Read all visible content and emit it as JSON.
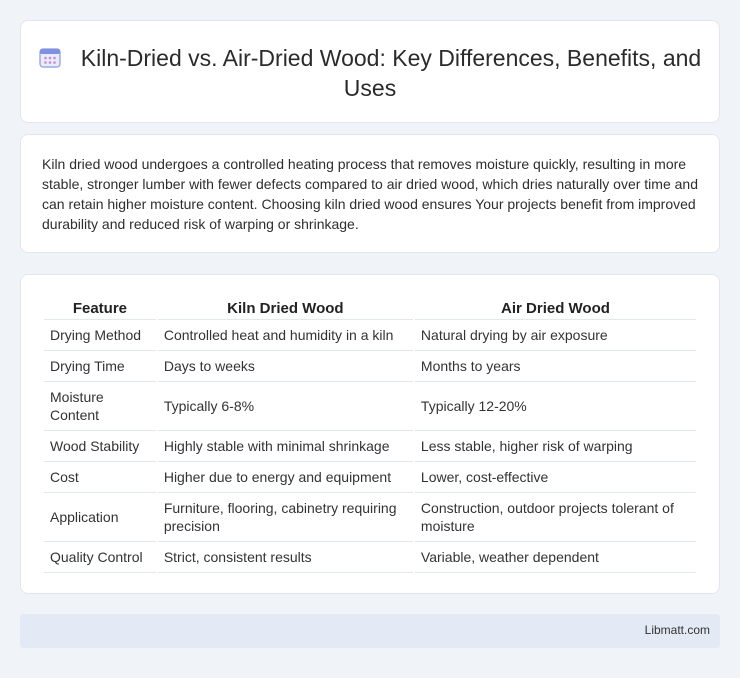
{
  "header": {
    "icon": "calendar-icon",
    "title": "Kiln-Dried vs. Air-Dried Wood: Key Differences, Benefits, and Uses"
  },
  "intro": {
    "text": "Kiln dried wood undergoes a controlled heating process that removes moisture quickly, resulting in more stable, stronger lumber with fewer defects compared to air dried wood, which dries naturally over time and can retain higher moisture content. Choosing kiln dried wood ensures Your projects benefit from improved durability and reduced risk of warping or shrinkage."
  },
  "table": {
    "headers": [
      "Feature",
      "Kiln Dried Wood",
      "Air Dried Wood"
    ],
    "rows": [
      [
        "Drying Method",
        "Controlled heat and humidity in a kiln",
        "Natural drying by air exposure"
      ],
      [
        "Drying Time",
        "Days to weeks",
        "Months to years"
      ],
      [
        "Moisture Content",
        "Typically 6-8%",
        "Typically 12-20%"
      ],
      [
        "Wood Stability",
        "Highly stable with minimal shrinkage",
        "Less stable, higher risk of warping"
      ],
      [
        "Cost",
        "Higher due to energy and equipment",
        "Lower, cost-effective"
      ],
      [
        "Application",
        "Furniture, flooring, cabinetry requiring precision",
        "Construction, outdoor projects tolerant of moisture"
      ],
      [
        "Quality Control",
        "Strict, consistent results",
        "Variable, weather dependent"
      ]
    ]
  },
  "footer": {
    "brand": "Libmatt.com"
  },
  "colors": {
    "page_bg": "#f0f3f8",
    "card_bg": "#ffffff",
    "footer_bg": "#e4eaf5",
    "icon_accent": "#6b7fd6"
  }
}
